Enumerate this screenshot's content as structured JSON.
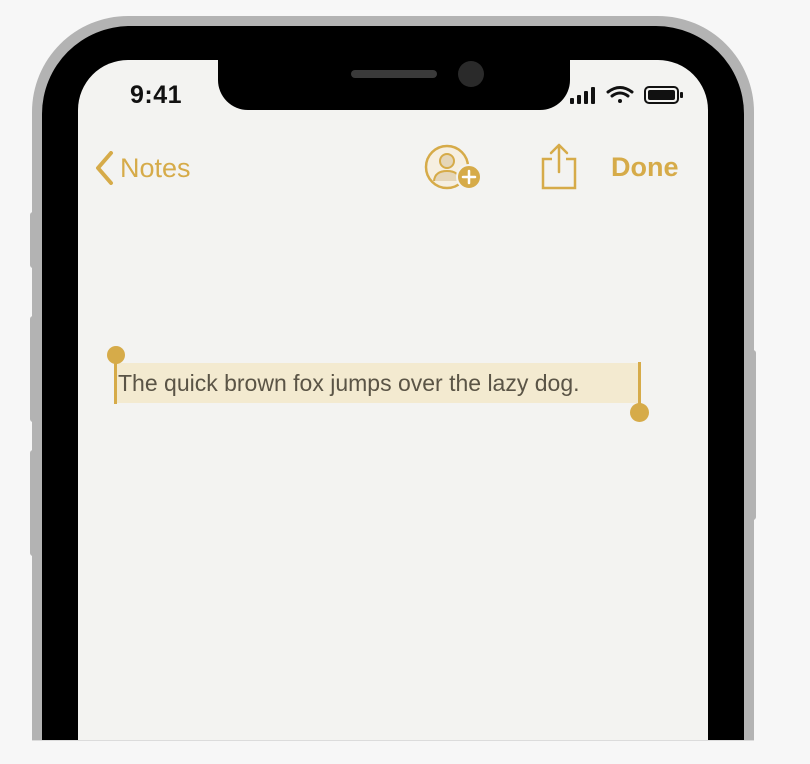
{
  "status_bar": {
    "time": "9:41",
    "icons": [
      "signal-icon",
      "wifi-icon",
      "battery-icon"
    ]
  },
  "nav": {
    "back_label": "Notes",
    "add_person_icon": "add-person-icon",
    "share_icon": "share-icon",
    "done_label": "Done"
  },
  "note": {
    "text": "The quick brown fox jumps over the lazy dog."
  },
  "colors": {
    "accent": "#d6ab49",
    "selection": "#f3ead0",
    "paper": "#f3f3f1",
    "text": "#5a5446"
  }
}
